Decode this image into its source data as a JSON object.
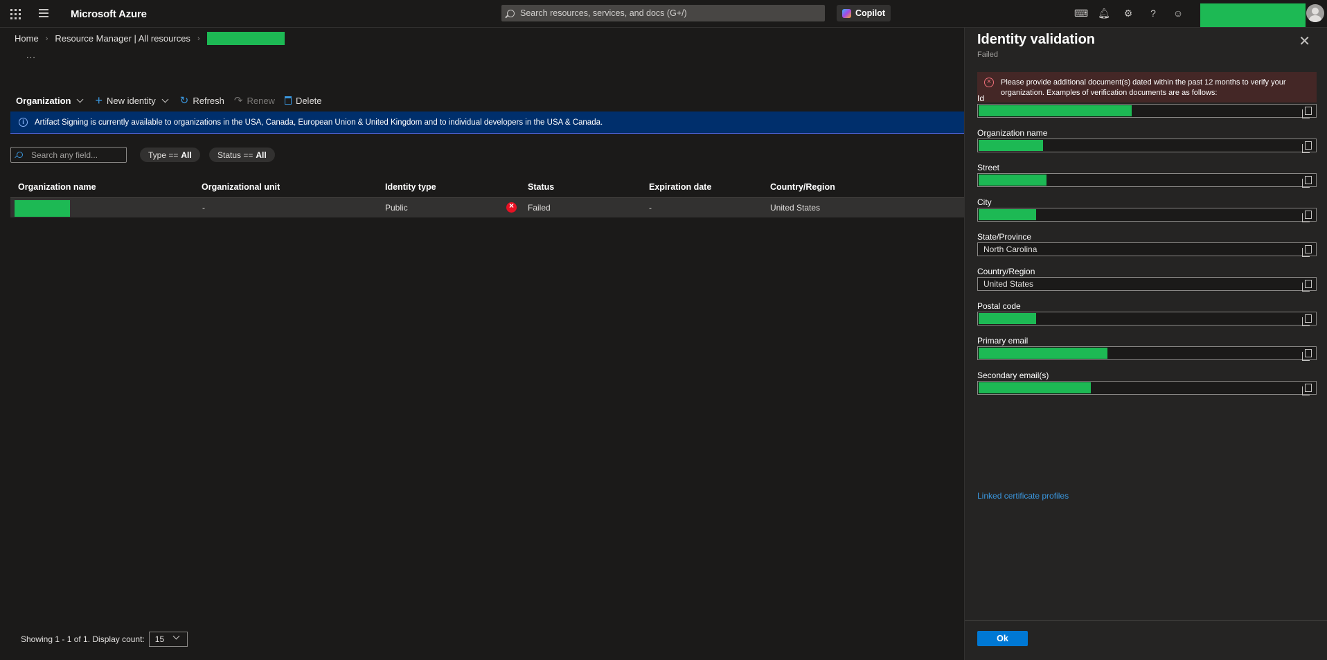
{
  "topbar": {
    "brand": "Microsoft Azure",
    "search_placeholder": "Search resources, services, and docs (G+/)",
    "copilot_label": "Copilot",
    "icons": [
      "cloud-shell-icon",
      "bell-icon",
      "gear-icon",
      "help-icon",
      "feedback-icon"
    ],
    "account_redacted": true
  },
  "breadcrumb": {
    "home": "Home",
    "resource_manager": "Resource Manager | All resources",
    "current_redacted": true
  },
  "more_label": "...",
  "toolbar": {
    "organization": "Organization",
    "new_identity": "New identity",
    "refresh": "Refresh",
    "renew": "Renew",
    "delete": "Delete"
  },
  "banner": {
    "text": "Artifact Signing is currently available to organizations in the USA, Canada, European Union & United Kingdom and to individual developers in the USA & Canada."
  },
  "filters": {
    "search_placeholder": "Search any field...",
    "type_label": "Type ==",
    "type_value": "All",
    "status_label": "Status ==",
    "status_value": "All"
  },
  "table": {
    "columns": [
      "Organization name",
      "Organizational unit",
      "Identity type",
      "Status",
      "Expiration date",
      "Country/Region"
    ],
    "rows": [
      {
        "organization_name_redacted": true,
        "organizational_unit": "-",
        "identity_type": "Public",
        "status": "Failed",
        "expiration_date": "-",
        "country_region": "United States"
      }
    ]
  },
  "footer": {
    "showing": "Showing 1 - 1 of 1. Display count:",
    "display_count": "15"
  },
  "panel": {
    "title": "Identity validation",
    "subtitle": "Failed",
    "error_text": "Please provide additional document(s) dated within the past 12 months to verify your organization. Examples of verification documents are as follows:",
    "fields": [
      {
        "label": "Id",
        "value": "",
        "redact_fill": 0.45
      },
      {
        "label": "Organization name",
        "value": "",
        "redact_fill": 0.19
      },
      {
        "label": "Street",
        "value": "",
        "redact_fill": 0.2
      },
      {
        "label": "City",
        "value": "",
        "redact_fill": 0.17
      },
      {
        "label": "State/Province",
        "value": "North Carolina",
        "redact_fill": 0
      },
      {
        "label": "Country/Region",
        "value": "United States",
        "redact_fill": 0
      },
      {
        "label": "Postal code",
        "value": "",
        "redact_fill": 0.17
      },
      {
        "label": "Primary email",
        "value": "",
        "redact_fill": 0.38
      },
      {
        "label": "Secondary email(s)",
        "value": "",
        "redact_fill": 0.33
      }
    ],
    "link": "Linked certificate profiles",
    "ok_label": "Ok"
  },
  "colors": {
    "accent": "#0078d4",
    "redaction": "#1db954",
    "error": "#e81123",
    "banner": "#002f6c"
  }
}
